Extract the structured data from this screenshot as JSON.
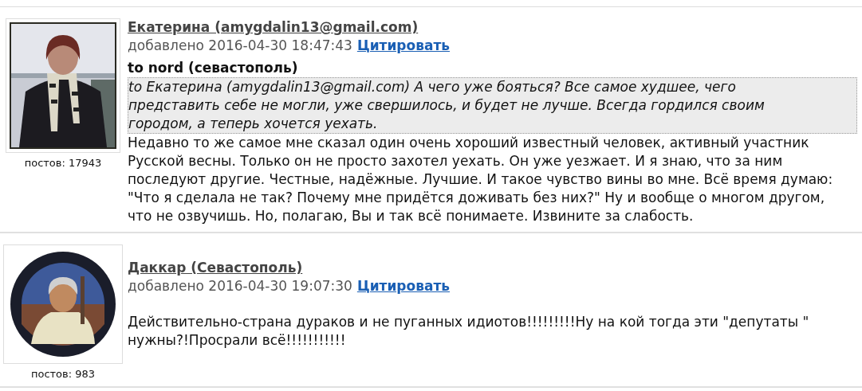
{
  "posts": [
    {
      "author": "Екатерина (amygdalin13@gmail.com)",
      "added": "добавлено 2016-04-30 18:47:43",
      "quote_link": "Цитировать",
      "post_count": "постов: 17943",
      "avatar": {
        "kind": "portrait"
      },
      "subject": "to nord (севастополь)",
      "quote": "to Екатерина (amygdalin13@gmail.com) А чего уже бояться? Все самое худшее, чего представить себе не могли, уже свершилось, и будет не лучше. Всегда гордился своим городом, а теперь хочется уехать.",
      "body": "Недавно то же самое мне сказал один очень хороший известный человек, активный участник Русской весны. Только он не просто захотел уехать. Он уже уезжает. И я знаю, что за ним последуют другие. Честные, надёжные. Лучшие. И такое чувство вины во мне. Всё время думаю: \"Что я сделала не так? Почему мне придётся доживать без них?\" Ну и вообще о многом другом, что не озвучишь. Но, полагаю, Вы и так всё понимаете. Извините за слабость."
    },
    {
      "author": "Даккар (Севастополь)",
      "added": "добавлено 2016-04-30 19:07:30",
      "quote_link": "Цитировать",
      "post_count": "постов: 983",
      "avatar": {
        "kind": "badge"
      },
      "body": "Действительно-страна дураков и не пуганных идиотов!!!!!!!!!Ну на кой тогда эти \"депутаты \" нужны?!Просрали всё!!!!!!!!!!!"
    }
  ]
}
